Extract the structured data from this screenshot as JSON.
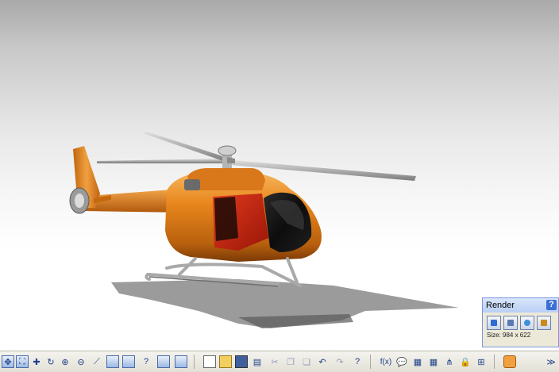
{
  "colors": {
    "fuselage": "#e8861c",
    "fuselage_dark": "#a8520a",
    "door_red": "#cf2412",
    "canopy": "#141414",
    "metal": "#8a8a8a"
  },
  "render_panel": {
    "title": "Render",
    "help": "?",
    "size_text": "Size: 984 x 622",
    "icons": [
      "render-icon",
      "render-settings-icon",
      "capture-icon",
      "render-scene-icon"
    ]
  },
  "toolbar": {
    "items": [
      "pan-icon",
      "fit-all-icon",
      "move-icon",
      "rotate-icon",
      "zoom-in-icon",
      "zoom-out-icon",
      "normal-view-icon",
      "multi-view-icon",
      "isometric-view-icon",
      "help-icon",
      "shading-icon",
      "hide-show-icon",
      "new-icon",
      "open-icon",
      "save-icon",
      "print-icon",
      "cut-icon",
      "copy-icon",
      "paste-icon",
      "undo-icon",
      "redo-icon",
      "whats-this-icon",
      "formula-icon",
      "comment-icon",
      "table-icon",
      "tree-icon",
      "lock-icon",
      "compass-icon",
      "render-toolbar-icon"
    ]
  }
}
